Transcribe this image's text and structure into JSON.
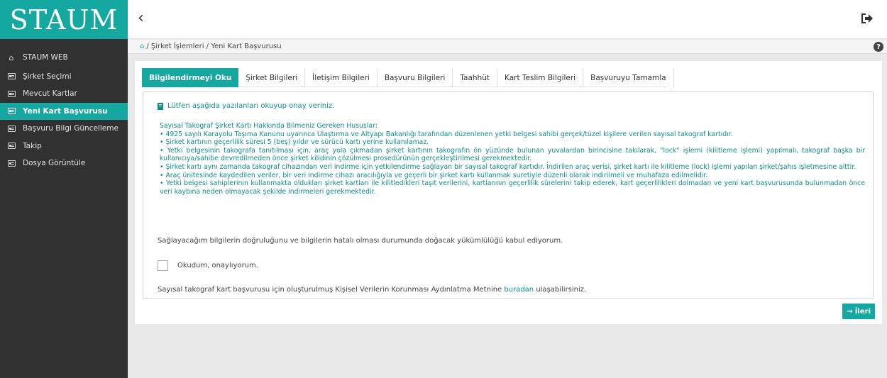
{
  "app": {
    "logo": "STAUM"
  },
  "sidebar": {
    "items": [
      {
        "label": "STAUM WEB",
        "icon": "home-icon"
      },
      {
        "label": "Şirket Seçimi",
        "icon": "id-card-icon"
      },
      {
        "label": "Mevcut Kartlar",
        "icon": "id-card-icon"
      },
      {
        "label": "Yeni Kart Başvurusu",
        "icon": "id-card-icon",
        "active": true
      },
      {
        "label": "Başvuru Bilgi Güncelleme",
        "icon": "id-card-icon"
      },
      {
        "label": "Takip",
        "icon": "id-card-icon"
      },
      {
        "label": "Dosya Görüntüle",
        "icon": "id-card-icon"
      }
    ]
  },
  "header": {
    "back_icon": "chevron-left-icon",
    "logout_icon": "sign-out-icon"
  },
  "breadcrumb": {
    "text": "/ Şirket İşlemleri / Yeni Kart Başvurusu"
  },
  "tabs": [
    {
      "label": "Bilgilendirmeyi Oku",
      "active": true
    },
    {
      "label": "Şirket Bilgileri"
    },
    {
      "label": "İletişim Bilgileri"
    },
    {
      "label": "Başvuru Bilgileri"
    },
    {
      "label": "Taahhüt"
    },
    {
      "label": "Kart Teslim Bilgileri"
    },
    {
      "label": "Başvuruyu Tamamla"
    }
  ],
  "content": {
    "notice": "Lütfen aşağıda yazılanları okuyup onay veriniz.",
    "info_title": "Sayısal Takograf Şirket Kartı Hakkında Bilmeniz Gereken Hususlar:",
    "bullets": [
      "• 4925 sayılı Karayolu Taşıma Kanunu uyarınca Ulaştırma ve Altyapı Bakanlığı tarafından düzenlenen yetki belgesi sahibi gerçek/tüzel kişilere verilen sayısal takograf kartıdır.",
      "• Şirket kartının geçerlilik süresi 5 (beş) yıldır ve sürücü kartı yerine kullanılamaz.",
      "• Yetki belgesinin takografa tanıtılması için, araç yola çıkmadan şirket kartının takografın ön yüzünde bulunan yuvalardan birincisine takılarak, \"lock\" işlemi (kilitleme işlemi) yapılmalı, takograf başka bir kullanıcıya/sahibe devredilmeden önce şirket kilidinin çözülmesi prosedürünün gerçekleştirilmesi gerekmektedir.",
      "• Şirket kartı aynı zamanda takograf cihazından veri indirme için yetkilendirme sağlayan bir sayısal takograf kartıdır. İndirilen araç verisi, şirket kartı ile kilitleme (lock) işlemi yapılan şirket/şahıs işletmesine aittir.",
      "• Araç ünitesinde kaydedilen veriler, bir veri indirme cihazı aracılığıyla ve geçerli bir şirket kartı kullanmak suretiyle düzenli olarak indirilmeli ve muhafaza edilmelidir.",
      "• Yetki belgesi sahiplerinin kullanmakta oldukları şirket kartları ile kilitledikleri taşıt verilerini, kartlarının geçerlilik sürelerini takip ederek, kart geçerlilikleri dolmadan ve yeni kart başvurusunda bulunmadan önce veri kaybına neden olmayacak şekilde indirmeleri gerekmektedir."
    ],
    "accept_text": "Sağlayacağım bilgilerin doğruluğunu ve bilgilerin hatalı olması durumunda doğacak yükümlülüğü kabul ediyorum.",
    "checkbox_label": "Okudum, onaylıyorum.",
    "checkbox_checked": false,
    "kvkk_before": "Sayısal takograf kart başvurusu için oluşturulmuş Kişisel Verilerin Korunması Aydınlatma Metnine ",
    "kvkk_link": "buradan",
    "kvkk_after": " ulaşabilirsiniz."
  },
  "actions": {
    "next_label": "İleri",
    "next_icon": "arrow-right-icon"
  },
  "colors": {
    "accent": "#14a8a0",
    "info_text": "#0b8f88",
    "sidebar_bg": "#313131"
  }
}
